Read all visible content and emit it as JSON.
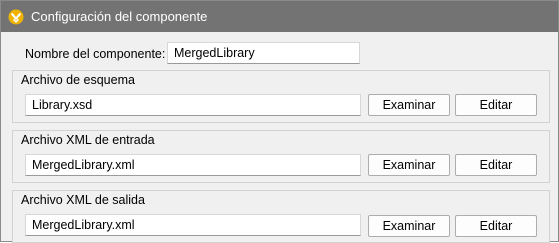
{
  "window": {
    "title": "Configuración del componente",
    "icon": "altova-mapforce-icon",
    "accent_color": "#f0b400"
  },
  "component": {
    "name_label": "Nombre del componente:",
    "name_value": "MergedLibrary"
  },
  "groups": [
    {
      "legend": "Archivo de esquema",
      "value": "Library.xsd",
      "browse_label": "Examinar",
      "edit_label": "Editar"
    },
    {
      "legend": "Archivo XML de entrada",
      "value": "MergedLibrary.xml",
      "browse_label": "Examinar",
      "edit_label": "Editar"
    },
    {
      "legend": "Archivo XML de salida",
      "value": "MergedLibrary.xml",
      "browse_label": "Examinar",
      "edit_label": "Editar"
    }
  ]
}
